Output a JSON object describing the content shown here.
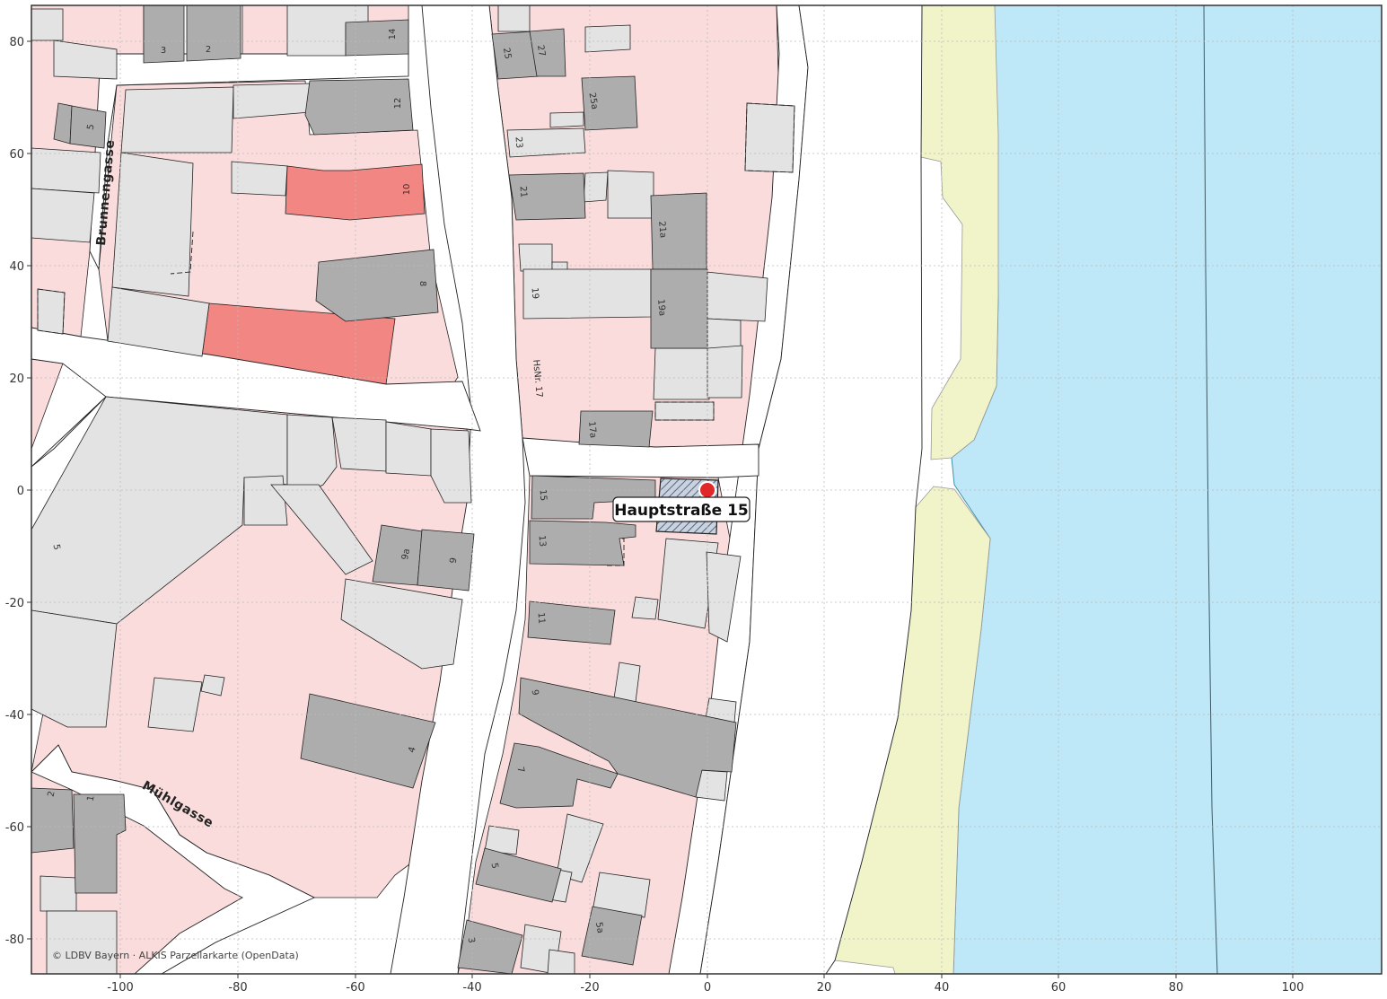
{
  "map": {
    "marker": {
      "address_label": "Hauptstraße 15",
      "color": "#e02828"
    },
    "attribution": "© LDBV Bayern · ALKIS Parzellarkarte (OpenData)",
    "street_names": {
      "brunnengasse": "Brunnengasse",
      "muhlgasse": "Mühlgasse"
    },
    "house_numbers": {
      "n3": "3",
      "n2": "2",
      "n14": "14",
      "n5": "5",
      "n12": "12",
      "n10": "10",
      "n8": "8",
      "n25": "25",
      "n27": "27",
      "n25a": "25a",
      "n23": "23",
      "n21": "21",
      "n21a": "21a",
      "n19": "19",
      "n19a": "19a",
      "hsnr17": "HsNr. 17",
      "n17a": "17a",
      "n15": "15",
      "n13": "13",
      "n9a": "9a",
      "n9": "9",
      "n11": "11",
      "n9b": "9",
      "n7": "7",
      "n4": "4",
      "n5b": "5",
      "n5a": "5a",
      "n3b": "3",
      "n2b": "2",
      "n1": "1",
      "n5c": "5"
    },
    "x_axis": {
      "ticks": [
        "-100",
        "-80",
        "-60",
        "-40",
        "-20",
        "0",
        "20",
        "40",
        "60",
        "80",
        "100"
      ]
    },
    "y_axis": {
      "ticks": [
        "80",
        "60",
        "40",
        "20",
        "0",
        "-20",
        "-40",
        "-60",
        "-80"
      ]
    },
    "colors": {
      "parcel": "#fbdcdc",
      "parcel_highlight": "#f28682",
      "building_main": "#adadad",
      "building_aux": "#e3e3e3",
      "water": "#bee7f7",
      "riverbank": "#f1f4c9",
      "road": "#ffffff",
      "grid": "#bbbbbb"
    }
  }
}
